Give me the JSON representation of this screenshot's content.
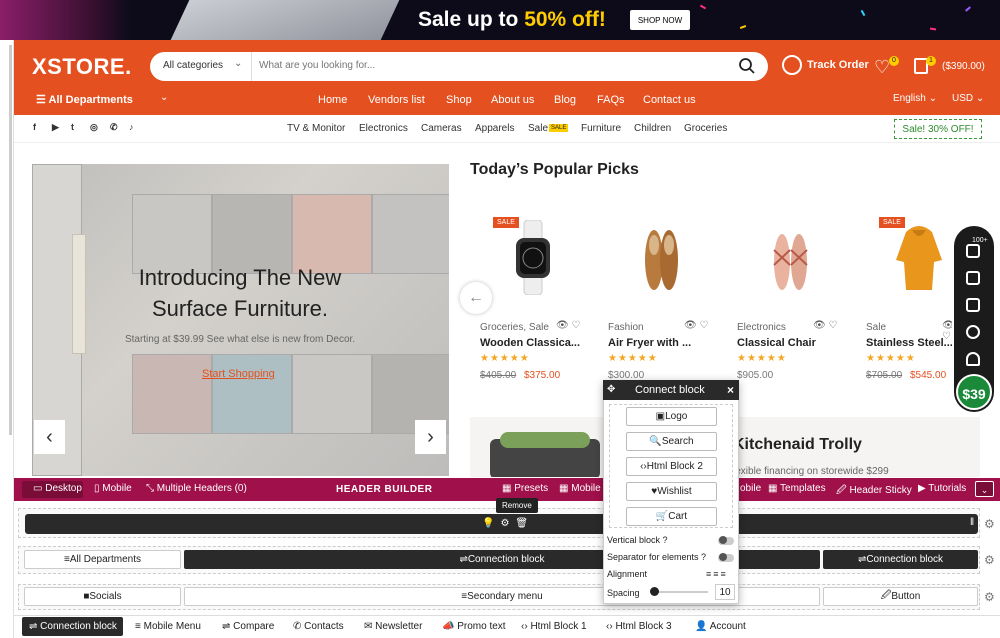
{
  "banner": {
    "text_pre": "Sale up to ",
    "text_hl": "50% off!",
    "button": "SHOP NOW"
  },
  "header": {
    "logo": "XSTORE.",
    "category": "All categories",
    "search_placeholder": "What are you looking for...",
    "track_order": "Track Order",
    "wishlist_count": "0",
    "cart_count": "1",
    "cart_total": "($390.00)"
  },
  "nav": {
    "all_departments": "All Departments",
    "items": [
      "Home",
      "Vendors list",
      "Shop",
      "About us",
      "Blog",
      "FAQs",
      "Contact us"
    ],
    "language": "English ⌄",
    "currency": "USD ⌄"
  },
  "subnav": {
    "socials": [
      "f",
      "▶",
      "t",
      "◎",
      "✆",
      "♪"
    ],
    "items": [
      "TV & Monitor",
      "Electronics",
      "Cameras",
      "Apparels",
      "Sale",
      "Furniture",
      "Children",
      "Groceries"
    ],
    "sale_badge": "SALE",
    "promo": "Sale! 30% OFF!"
  },
  "hero": {
    "title_line1": "Introducing The New",
    "title_line2": "Surface Furniture.",
    "subtitle": "Starting at $39.99 See what else is new from Decor.",
    "cta": "Start Shopping"
  },
  "products": {
    "title": "Today’s Popular Picks",
    "sale_label": "SALE",
    "items": [
      {
        "category": "Groceries, Sale",
        "name": "Wooden Classica...",
        "stars": "★★★★★",
        "old_price": "$405.00",
        "price": "$375.00"
      },
      {
        "category": "Fashion",
        "name": "Air Fryer with ...",
        "stars": "★★★★★",
        "old_price": "",
        "price": "$300.00"
      },
      {
        "category": "Electronics",
        "name": "Classical Chair",
        "stars": "★★★★★",
        "old_price": "",
        "price": "$905.00"
      },
      {
        "category": "Sale",
        "name": "Stainless Steel...",
        "stars": "★★★★★",
        "old_price": "$705.00",
        "price": "$545.00"
      }
    ]
  },
  "promo2": {
    "title": "Kitchenaid Trolly",
    "subtitle": "lexible financing on storewide $299"
  },
  "sidebar": {
    "count": "100+",
    "price_badge": "$39"
  },
  "builder": {
    "desktop": "Desktop",
    "mobile": "Mobile",
    "multiple_headers": "Multiple Headers (0)",
    "title": "HEADER BUILDER",
    "presets": "Presets",
    "mobile2": "Mobile I",
    "mobile3": "obile",
    "templates": "Templates",
    "header_sticky": "Header Sticky",
    "tutorials": "Tutorials",
    "remove_tooltip": "Remove",
    "row2": {
      "all_departments": "All Departments",
      "connection_block": "Connection block",
      "connection_block_right": "Connection block"
    },
    "row3": {
      "socials": "Socials",
      "secondary_menu": "Secondary menu",
      "button": "Button"
    }
  },
  "bottom_bar": [
    "Connection block",
    "Mobile Menu",
    "Compare",
    "Contacts",
    "Newsletter",
    "Promo text",
    "Html Block 1",
    "Html Block 3",
    "Account"
  ],
  "popup": {
    "title": "Connect block",
    "buttons": [
      "Logo",
      "Search",
      "Html Block 2",
      "Wishlist",
      "Cart"
    ],
    "vertical_block": "Vertical block ?",
    "separator": "Separator for elements ?",
    "alignment": "Alignment",
    "spacing": "Spacing",
    "spacing_value": "10"
  }
}
